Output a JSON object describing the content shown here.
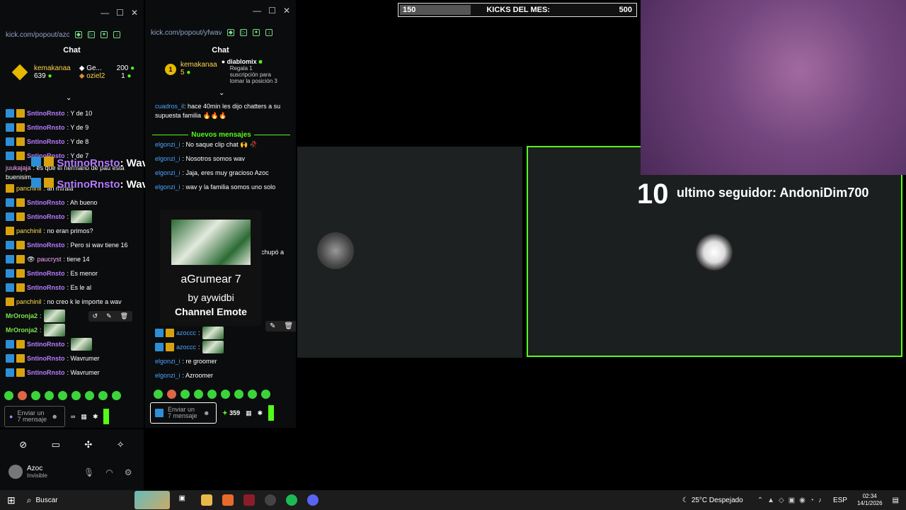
{
  "window1": {
    "url": "kick.com/popout/azoc",
    "chat_title": "Chat",
    "pinned": {
      "user1": "kemakanaa",
      "user1_count": "639",
      "user2": "Ge...",
      "user2_count": "200",
      "user3": "oziel2",
      "user3_count": "1"
    },
    "messages": [
      {
        "user": "SntinoRnsto",
        "text": ": Y de 10"
      },
      {
        "user": "SntinoRnsto",
        "text": ": Y de 9"
      },
      {
        "user": "SntinoRnsto",
        "text": ": Y de 8"
      },
      {
        "user": "SntinoRnsto",
        "text": ": Y de 7"
      },
      {
        "user": "juukajaja",
        "text": ": es que el hermano de pau está"
      },
      {
        "user": "buenisim",
        "text": ""
      },
      {
        "user": "panchinil",
        "text": ": ah mirala"
      },
      {
        "user": "SntinoRnsto",
        "text": ": Ah bueno"
      },
      {
        "user": "SntinoRnsto",
        "text": ":"
      },
      {
        "user": "panchinil",
        "text": ": no eran primos?"
      },
      {
        "user": "SntinoRnsto",
        "text": ": Pero si wav tiene 16"
      },
      {
        "user": "paucryst",
        "text": ": tiene 14"
      },
      {
        "user": "SntinoRnsto",
        "text": ": Es menor"
      },
      {
        "user": "SntinoRnsto",
        "text": ": Es le al"
      },
      {
        "user": "panchinil",
        "text": ": no creo k le importe a wav"
      },
      {
        "user": "MrOronja2",
        "text": ":"
      },
      {
        "user": "MrOronja2",
        "text": ":"
      },
      {
        "user": "SntinoRnsto",
        "text": ":"
      },
      {
        "user": "SntinoRnsto",
        "text": ": Wavrumer"
      },
      {
        "user": "SntinoRnsto",
        "text": ": Wavrumer"
      }
    ],
    "input_placeholder": "Enviar un 7 mensaje"
  },
  "overlay": {
    "line1_user": "SntinoRnsto",
    "line1_text": ": Wavrumer",
    "line2_user": "SntinoRnsto",
    "line2_text": ": Wavrumer"
  },
  "window2": {
    "url": "kick.com/popout/yfwav",
    "chat_title": "Chat",
    "pinned": {
      "user1": "kemakanaa",
      "user1_count": "5",
      "user2": "diablomix",
      "gift_text": "Regala 1 suscripción para tomar la posición 3"
    },
    "top_message": {
      "user": "cuadros_il",
      "text": ": hace 40min les dijo chatters a su supuesta familia 🔥🔥🔥"
    },
    "new_messages_label": "Nuevos mensajes",
    "messages": [
      {
        "user": "elgonzi_i",
        "text": ": No saque clip chat 🙌 🥀"
      },
      {
        "user": "elgonzi_i",
        "text": ": Nosotros somos wav"
      },
      {
        "user": "elgonzi_i",
        "text": ": Jaja, eres muy gracioso Azoc"
      },
      {
        "user": "elgonzi_i",
        "text": ": wav y la familia somos uno solo"
      }
    ],
    "partial_text": "chupó a",
    "tooltip": {
      "emote_name": "aGrumear 7",
      "by": "by aywidbi",
      "type": "Channel Emote"
    },
    "late_messages": [
      {
        "user": "azoccc",
        "text": ":"
      },
      {
        "user": "azoccc",
        "text": ":"
      },
      {
        "user": "elgonzi_i",
        "text": ": re groomer"
      },
      {
        "user": "elgonzi_i",
        "text": ": Azroomer"
      }
    ],
    "input_placeholder": "Enviar un 7 mensaje",
    "kicks_count": "359"
  },
  "stream": {
    "kicks_current": "150",
    "kicks_label": "KICKS DEL MES:",
    "kicks_goal": "500",
    "kicks_progress": 0.3,
    "follower_number": "10",
    "follower_label": "ultimo seguidor: AndoniDim700"
  },
  "discord": {
    "username": "Azoc",
    "status": "Invisible"
  },
  "taskbar": {
    "search": "Buscar",
    "weather": "25°C Despejado",
    "lang": "ESP",
    "time": "02:34",
    "date": "14/1/2026"
  },
  "colors": {
    "kick_green": "#53fc18",
    "username_purple": "#b57cff"
  }
}
